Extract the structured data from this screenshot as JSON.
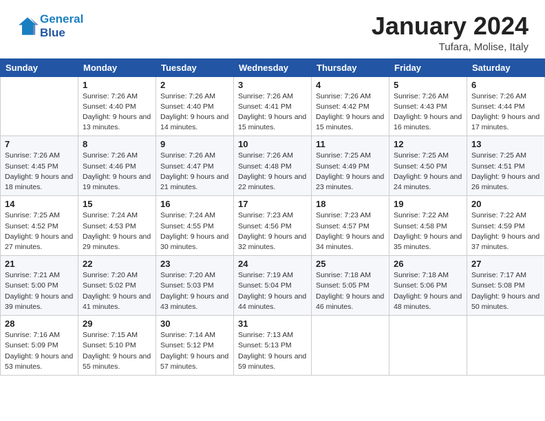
{
  "header": {
    "logo_line1": "General",
    "logo_line2": "Blue",
    "month": "January 2024",
    "location": "Tufara, Molise, Italy"
  },
  "weekdays": [
    "Sunday",
    "Monday",
    "Tuesday",
    "Wednesday",
    "Thursday",
    "Friday",
    "Saturday"
  ],
  "weeks": [
    [
      {
        "day": "",
        "sunrise": "",
        "sunset": "",
        "daylight": ""
      },
      {
        "day": "1",
        "sunrise": "Sunrise: 7:26 AM",
        "sunset": "Sunset: 4:40 PM",
        "daylight": "Daylight: 9 hours and 13 minutes."
      },
      {
        "day": "2",
        "sunrise": "Sunrise: 7:26 AM",
        "sunset": "Sunset: 4:40 PM",
        "daylight": "Daylight: 9 hours and 14 minutes."
      },
      {
        "day": "3",
        "sunrise": "Sunrise: 7:26 AM",
        "sunset": "Sunset: 4:41 PM",
        "daylight": "Daylight: 9 hours and 15 minutes."
      },
      {
        "day": "4",
        "sunrise": "Sunrise: 7:26 AM",
        "sunset": "Sunset: 4:42 PM",
        "daylight": "Daylight: 9 hours and 15 minutes."
      },
      {
        "day": "5",
        "sunrise": "Sunrise: 7:26 AM",
        "sunset": "Sunset: 4:43 PM",
        "daylight": "Daylight: 9 hours and 16 minutes."
      },
      {
        "day": "6",
        "sunrise": "Sunrise: 7:26 AM",
        "sunset": "Sunset: 4:44 PM",
        "daylight": "Daylight: 9 hours and 17 minutes."
      }
    ],
    [
      {
        "day": "7",
        "sunrise": "Sunrise: 7:26 AM",
        "sunset": "Sunset: 4:45 PM",
        "daylight": "Daylight: 9 hours and 18 minutes."
      },
      {
        "day": "8",
        "sunrise": "Sunrise: 7:26 AM",
        "sunset": "Sunset: 4:46 PM",
        "daylight": "Daylight: 9 hours and 19 minutes."
      },
      {
        "day": "9",
        "sunrise": "Sunrise: 7:26 AM",
        "sunset": "Sunset: 4:47 PM",
        "daylight": "Daylight: 9 hours and 21 minutes."
      },
      {
        "day": "10",
        "sunrise": "Sunrise: 7:26 AM",
        "sunset": "Sunset: 4:48 PM",
        "daylight": "Daylight: 9 hours and 22 minutes."
      },
      {
        "day": "11",
        "sunrise": "Sunrise: 7:25 AM",
        "sunset": "Sunset: 4:49 PM",
        "daylight": "Daylight: 9 hours and 23 minutes."
      },
      {
        "day": "12",
        "sunrise": "Sunrise: 7:25 AM",
        "sunset": "Sunset: 4:50 PM",
        "daylight": "Daylight: 9 hours and 24 minutes."
      },
      {
        "day": "13",
        "sunrise": "Sunrise: 7:25 AM",
        "sunset": "Sunset: 4:51 PM",
        "daylight": "Daylight: 9 hours and 26 minutes."
      }
    ],
    [
      {
        "day": "14",
        "sunrise": "Sunrise: 7:25 AM",
        "sunset": "Sunset: 4:52 PM",
        "daylight": "Daylight: 9 hours and 27 minutes."
      },
      {
        "day": "15",
        "sunrise": "Sunrise: 7:24 AM",
        "sunset": "Sunset: 4:53 PM",
        "daylight": "Daylight: 9 hours and 29 minutes."
      },
      {
        "day": "16",
        "sunrise": "Sunrise: 7:24 AM",
        "sunset": "Sunset: 4:55 PM",
        "daylight": "Daylight: 9 hours and 30 minutes."
      },
      {
        "day": "17",
        "sunrise": "Sunrise: 7:23 AM",
        "sunset": "Sunset: 4:56 PM",
        "daylight": "Daylight: 9 hours and 32 minutes."
      },
      {
        "day": "18",
        "sunrise": "Sunrise: 7:23 AM",
        "sunset": "Sunset: 4:57 PM",
        "daylight": "Daylight: 9 hours and 34 minutes."
      },
      {
        "day": "19",
        "sunrise": "Sunrise: 7:22 AM",
        "sunset": "Sunset: 4:58 PM",
        "daylight": "Daylight: 9 hours and 35 minutes."
      },
      {
        "day": "20",
        "sunrise": "Sunrise: 7:22 AM",
        "sunset": "Sunset: 4:59 PM",
        "daylight": "Daylight: 9 hours and 37 minutes."
      }
    ],
    [
      {
        "day": "21",
        "sunrise": "Sunrise: 7:21 AM",
        "sunset": "Sunset: 5:00 PM",
        "daylight": "Daylight: 9 hours and 39 minutes."
      },
      {
        "day": "22",
        "sunrise": "Sunrise: 7:20 AM",
        "sunset": "Sunset: 5:02 PM",
        "daylight": "Daylight: 9 hours and 41 minutes."
      },
      {
        "day": "23",
        "sunrise": "Sunrise: 7:20 AM",
        "sunset": "Sunset: 5:03 PM",
        "daylight": "Daylight: 9 hours and 43 minutes."
      },
      {
        "day": "24",
        "sunrise": "Sunrise: 7:19 AM",
        "sunset": "Sunset: 5:04 PM",
        "daylight": "Daylight: 9 hours and 44 minutes."
      },
      {
        "day": "25",
        "sunrise": "Sunrise: 7:18 AM",
        "sunset": "Sunset: 5:05 PM",
        "daylight": "Daylight: 9 hours and 46 minutes."
      },
      {
        "day": "26",
        "sunrise": "Sunrise: 7:18 AM",
        "sunset": "Sunset: 5:06 PM",
        "daylight": "Daylight: 9 hours and 48 minutes."
      },
      {
        "day": "27",
        "sunrise": "Sunrise: 7:17 AM",
        "sunset": "Sunset: 5:08 PM",
        "daylight": "Daylight: 9 hours and 50 minutes."
      }
    ],
    [
      {
        "day": "28",
        "sunrise": "Sunrise: 7:16 AM",
        "sunset": "Sunset: 5:09 PM",
        "daylight": "Daylight: 9 hours and 53 minutes."
      },
      {
        "day": "29",
        "sunrise": "Sunrise: 7:15 AM",
        "sunset": "Sunset: 5:10 PM",
        "daylight": "Daylight: 9 hours and 55 minutes."
      },
      {
        "day": "30",
        "sunrise": "Sunrise: 7:14 AM",
        "sunset": "Sunset: 5:12 PM",
        "daylight": "Daylight: 9 hours and 57 minutes."
      },
      {
        "day": "31",
        "sunrise": "Sunrise: 7:13 AM",
        "sunset": "Sunset: 5:13 PM",
        "daylight": "Daylight: 9 hours and 59 minutes."
      },
      {
        "day": "",
        "sunrise": "",
        "sunset": "",
        "daylight": ""
      },
      {
        "day": "",
        "sunrise": "",
        "sunset": "",
        "daylight": ""
      },
      {
        "day": "",
        "sunrise": "",
        "sunset": "",
        "daylight": ""
      }
    ]
  ]
}
